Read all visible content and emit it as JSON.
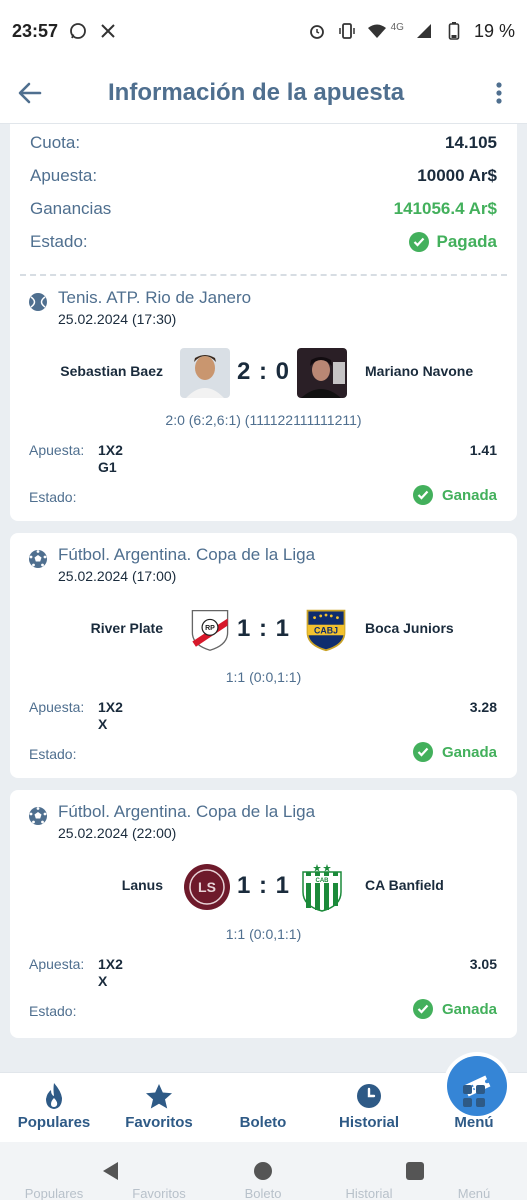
{
  "status_bar": {
    "time": "23:57",
    "network": "4G",
    "battery": "19 %"
  },
  "header": {
    "title": "Información de la apuesta"
  },
  "summary": {
    "odds_label": "Cuota:",
    "odds_value": "14.105",
    "stake_label": "Apuesta:",
    "stake_value": "10000 Ar$",
    "winnings_label": "Ganancias",
    "winnings_value": "141056.4 Ar$",
    "status_label": "Estado:",
    "status_value": "Pagada"
  },
  "events": [
    {
      "sport_icon": "tennis-ball-icon",
      "league": "Tenis. ATP. Rio de Janero",
      "date": "25.02.2024 (17:30)",
      "team1": "Sebastian Baez",
      "team2": "Mariano Navone",
      "score": "2 : 0",
      "detail": "2:0 (6:2,6:1) (111122111111211)",
      "bet_label": "Apuesta:",
      "bet_market": "1X2",
      "bet_selection": "G1",
      "odd": "1.41",
      "status_label": "Estado:",
      "status_value": "Ganada"
    },
    {
      "sport_icon": "soccer-ball-icon",
      "league": "Fútbol. Argentina. Copa de la Liga",
      "date": "25.02.2024 (17:00)",
      "team1": "River Plate",
      "team2": "Boca Juniors",
      "score": "1 : 1",
      "detail": "1:1 (0:0,1:1)",
      "bet_label": "Apuesta:",
      "bet_market": "1X2",
      "bet_selection": "X",
      "odd": "3.28",
      "status_label": "Estado:",
      "status_value": "Ganada"
    },
    {
      "sport_icon": "soccer-ball-icon",
      "league": "Fútbol. Argentina. Copa de la Liga",
      "date": "25.02.2024 (22:00)",
      "team1": "Lanus",
      "team2": "CA Banfield",
      "score": "1 : 1",
      "detail": "1:1 (0:0,1:1)",
      "bet_label": "Apuesta:",
      "bet_market": "1X2",
      "bet_selection": "X",
      "odd": "3.05",
      "status_label": "Estado:",
      "status_value": "Ganada"
    }
  ],
  "logos": {
    "river": "RP",
    "boca": "CABJ",
    "lanus": "LS",
    "banfield": "CAB"
  },
  "bottom_nav": {
    "populares": "Populares",
    "favoritos": "Favoritos",
    "boleto": "Boleto",
    "historial": "Historial",
    "menu": "Menú"
  },
  "colors": {
    "accent": "#3585d6",
    "title": "#4f6f8f",
    "win_green": "#43b05c",
    "background": "#eaeef2"
  }
}
